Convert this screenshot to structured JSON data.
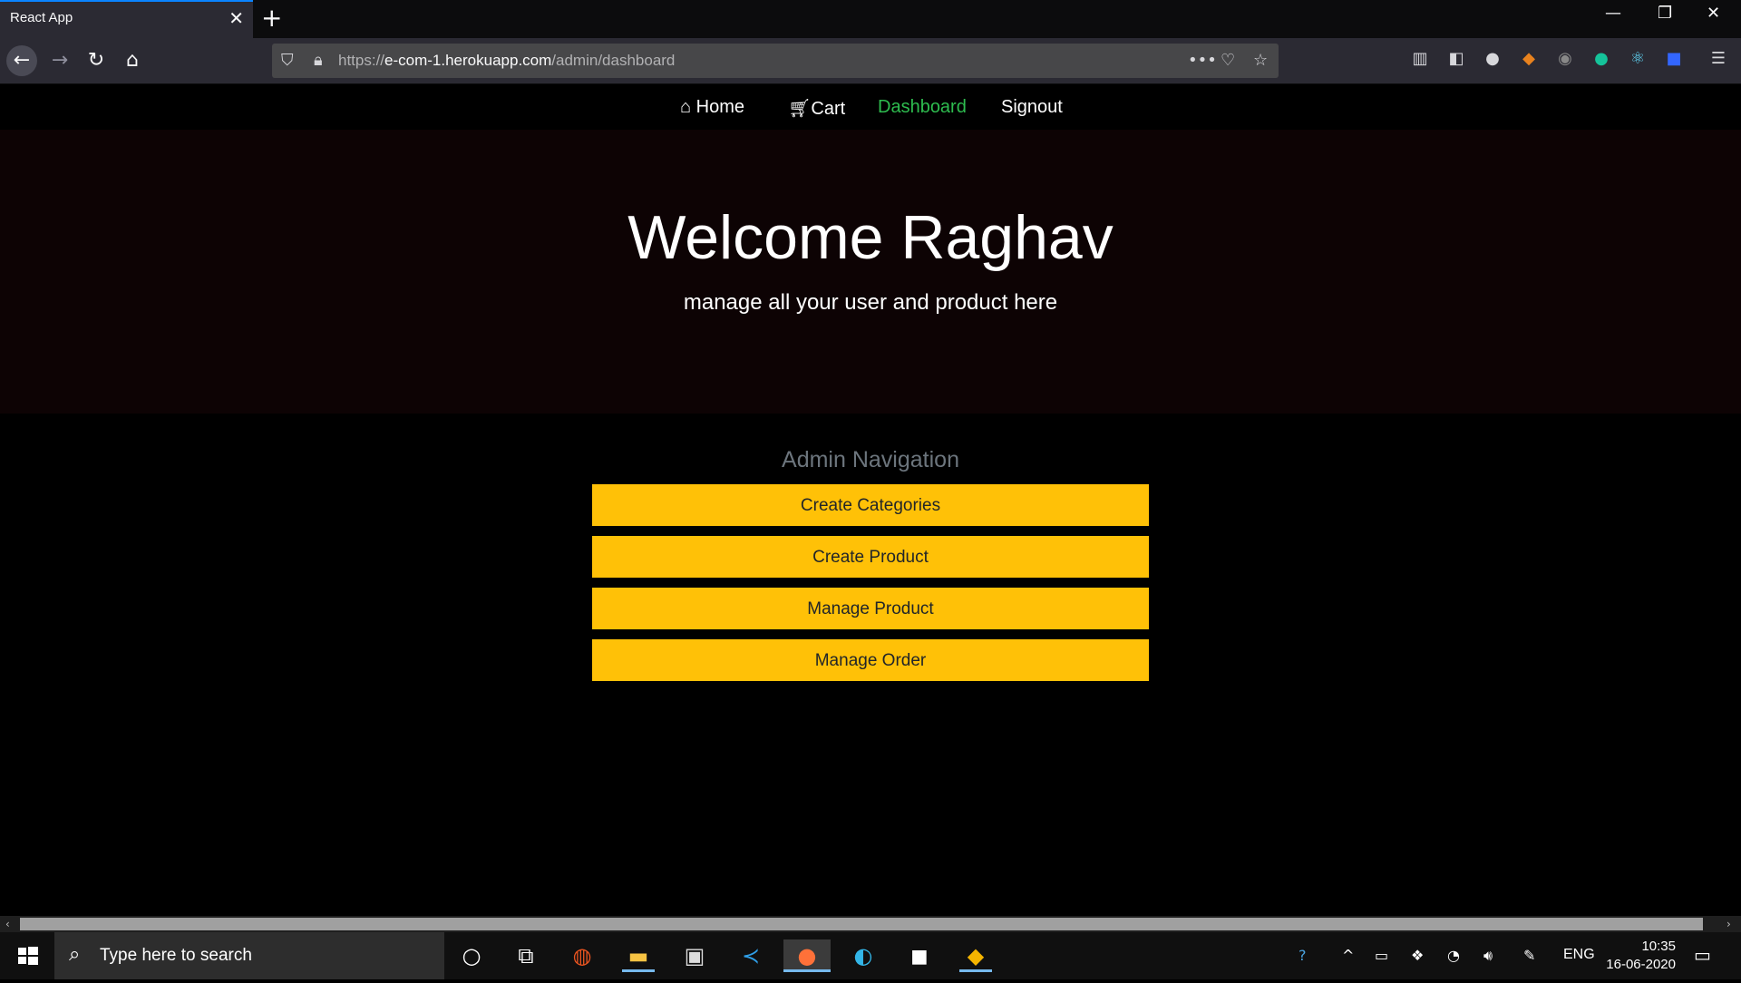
{
  "browser": {
    "tab_title": "React App",
    "url_prefix": "https://",
    "url_host": "e-com-1.herokuapp.com",
    "url_path": "/admin/dashboard"
  },
  "site_nav": {
    "home": "Home",
    "cart": "Cart",
    "dashboard": "Dashboard",
    "signout": "Signout"
  },
  "hero": {
    "title": "Welcome Raghav",
    "subtitle": "manage all your user and product here"
  },
  "admin": {
    "heading": "Admin Navigation",
    "buttons": [
      "Create Categories",
      "Create Product",
      "Manage Product",
      "Manage Order"
    ]
  },
  "taskbar": {
    "search_placeholder": "Type here to search",
    "language": "ENG",
    "time": "10:35",
    "date": "16-06-2020"
  },
  "colors": {
    "accent_button": "#ffc107",
    "active_nav": "#2ebc4f",
    "hero_bg": "#0d0304"
  }
}
